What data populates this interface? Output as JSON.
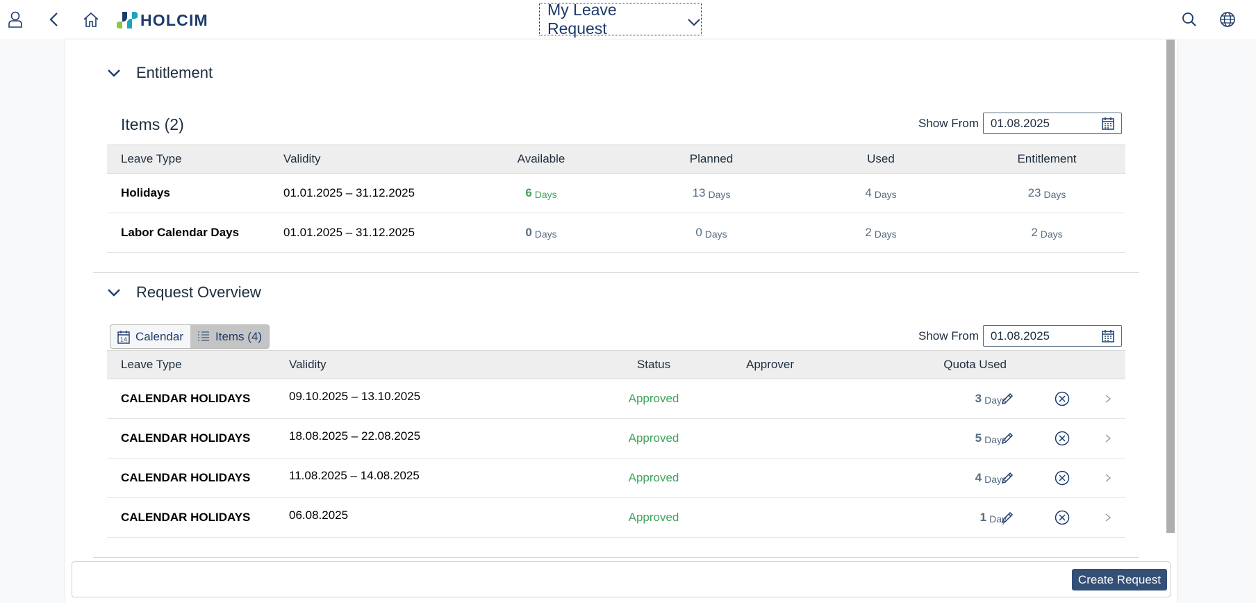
{
  "shell": {
    "brand": "HOLCIM",
    "title": "My Leave Request"
  },
  "entitlement": {
    "section_title": "Entitlement",
    "items_title": "Items (2)",
    "show_from_label": "Show From",
    "show_from_value": "01.08.2025",
    "columns": [
      "Leave Type",
      "Validity",
      "Available",
      "Planned",
      "Used",
      "Entitlement"
    ],
    "rows": [
      {
        "type": "Holidays",
        "validity": "01.01.2025 – 31.12.2025",
        "available": "6",
        "planned": "13",
        "used": "4",
        "entitlement": "23"
      },
      {
        "type": "Labor Calendar Days",
        "validity": "01.01.2025 – 31.12.2025",
        "available": "0",
        "planned": "0",
        "used": "2",
        "entitlement": "2"
      }
    ],
    "unit": "Days"
  },
  "requests": {
    "section_title": "Request Overview",
    "view_calendar": "Calendar",
    "view_items": "Items (4)",
    "show_from_label": "Show From",
    "show_from_value": "01.08.2025",
    "columns": [
      "Leave Type",
      "Validity",
      "Status",
      "Approver",
      "Quota Used"
    ],
    "rows": [
      {
        "type": "CALENDAR HOLIDAYS",
        "validity": "09.10.2025 – 13.10.2025",
        "status": "Approved",
        "approver": "",
        "quota": "3",
        "unit": "Days"
      },
      {
        "type": "CALENDAR HOLIDAYS",
        "validity": "18.08.2025 – 22.08.2025",
        "status": "Approved",
        "approver": "",
        "quota": "5",
        "unit": "Days"
      },
      {
        "type": "CALENDAR HOLIDAYS",
        "validity": "11.08.2025 – 14.08.2025",
        "status": "Approved",
        "approver": "",
        "quota": "4",
        "unit": "Days"
      },
      {
        "type": "CALENDAR HOLIDAYS",
        "validity": "06.08.2025",
        "status": "Approved",
        "approver": "",
        "quota": "1",
        "unit": "Day"
      }
    ]
  },
  "footer": {
    "create_label": "Create Request"
  },
  "colors": {
    "accent": "#345076",
    "status_green": "#3ea35a",
    "brand_blue": "#1c3b6b"
  },
  "icons": [
    "user-icon",
    "back-icon",
    "home-icon",
    "holcim-logo-icon",
    "chevron-down-icon",
    "search-icon",
    "globe-icon",
    "calendar-icon",
    "list-icon",
    "edit-icon",
    "cancel-icon",
    "chevron-right-icon"
  ]
}
